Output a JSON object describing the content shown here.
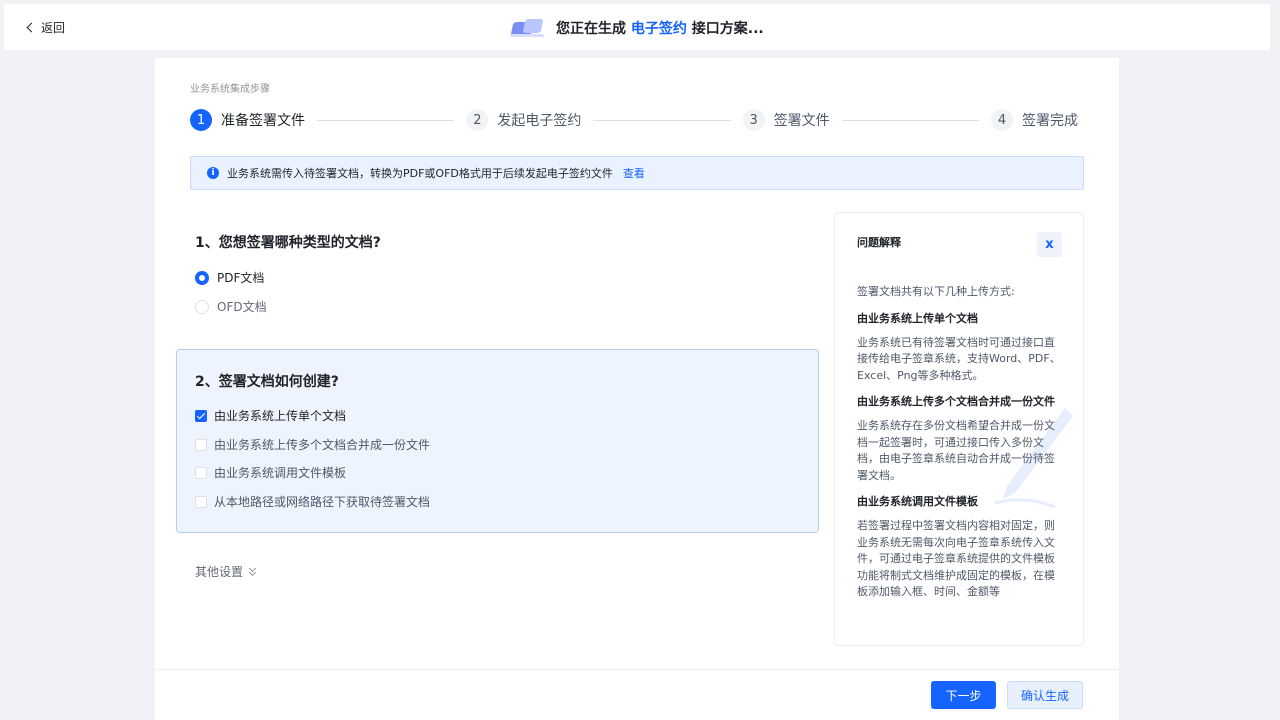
{
  "header": {
    "back_label": "返回",
    "title_prefix": "您正在生成",
    "title_highlight": "电子签约",
    "title_suffix": "接口方案..."
  },
  "steps": {
    "caption": "业务系统集成步骤",
    "items": [
      {
        "num": "1",
        "label": "准备签署文件"
      },
      {
        "num": "2",
        "label": "发起电子签约"
      },
      {
        "num": "3",
        "label": "签署文件"
      },
      {
        "num": "4",
        "label": "签署完成"
      }
    ],
    "active_index": 0
  },
  "info": {
    "icon": "info-icon",
    "text": "业务系统需传入待签署文档，转换为PDF或OFD格式用于后续发起电子签约文件",
    "link": "查看"
  },
  "q1": {
    "title": "1、您想签署哪种类型的文档?",
    "options": [
      "PDF文档",
      "OFD文档"
    ],
    "selected": "PDF文档"
  },
  "q2": {
    "title": "2、签署文档如何创建?",
    "options": [
      "由业务系统上传单个文档",
      "由业务系统上传多个文档合并成一份文件",
      "由业务系统调用文件模板",
      "从本地路径或网络路径下获取待签署文档"
    ],
    "checked": [
      "由业务系统上传单个文档"
    ]
  },
  "other_settings": {
    "label": "其他设置",
    "icon": "double-chevron-down-icon"
  },
  "side_panel": {
    "title": "问题解释",
    "close_glyph": "x",
    "intro": "签署文档共有以下几种上传方式:",
    "sections": [
      {
        "heading": "由业务系统上传单个文档",
        "body": "业务系统已有待签署文档时可通过接口直接传给电子签章系统，支持Word、PDF、Excel、Png等多种格式。"
      },
      {
        "heading": "由业务系统上传多个文档合并成一份文件",
        "body": "业务系统存在多份文档希望合并成一份文档一起签署时，可通过接口传入多份文档，由电子签章系统自动合并成一份待签署文档。"
      },
      {
        "heading": "由业务系统调用文件模板",
        "body": "若签署过程中签署文档内容相对固定，则业务系统无需每次向电子签章系统传入文件，可通过电子签章系统提供的文件模板功能将制式文档维护成固定的模板，在模板添加输入框、时间、金额等"
      }
    ]
  },
  "footer": {
    "next_label": "下一步",
    "confirm_label": "确认生成"
  },
  "colors": {
    "primary": "#1664ff",
    "info_bg": "#eaf2ff",
    "page_bg": "#f0f2f5"
  }
}
